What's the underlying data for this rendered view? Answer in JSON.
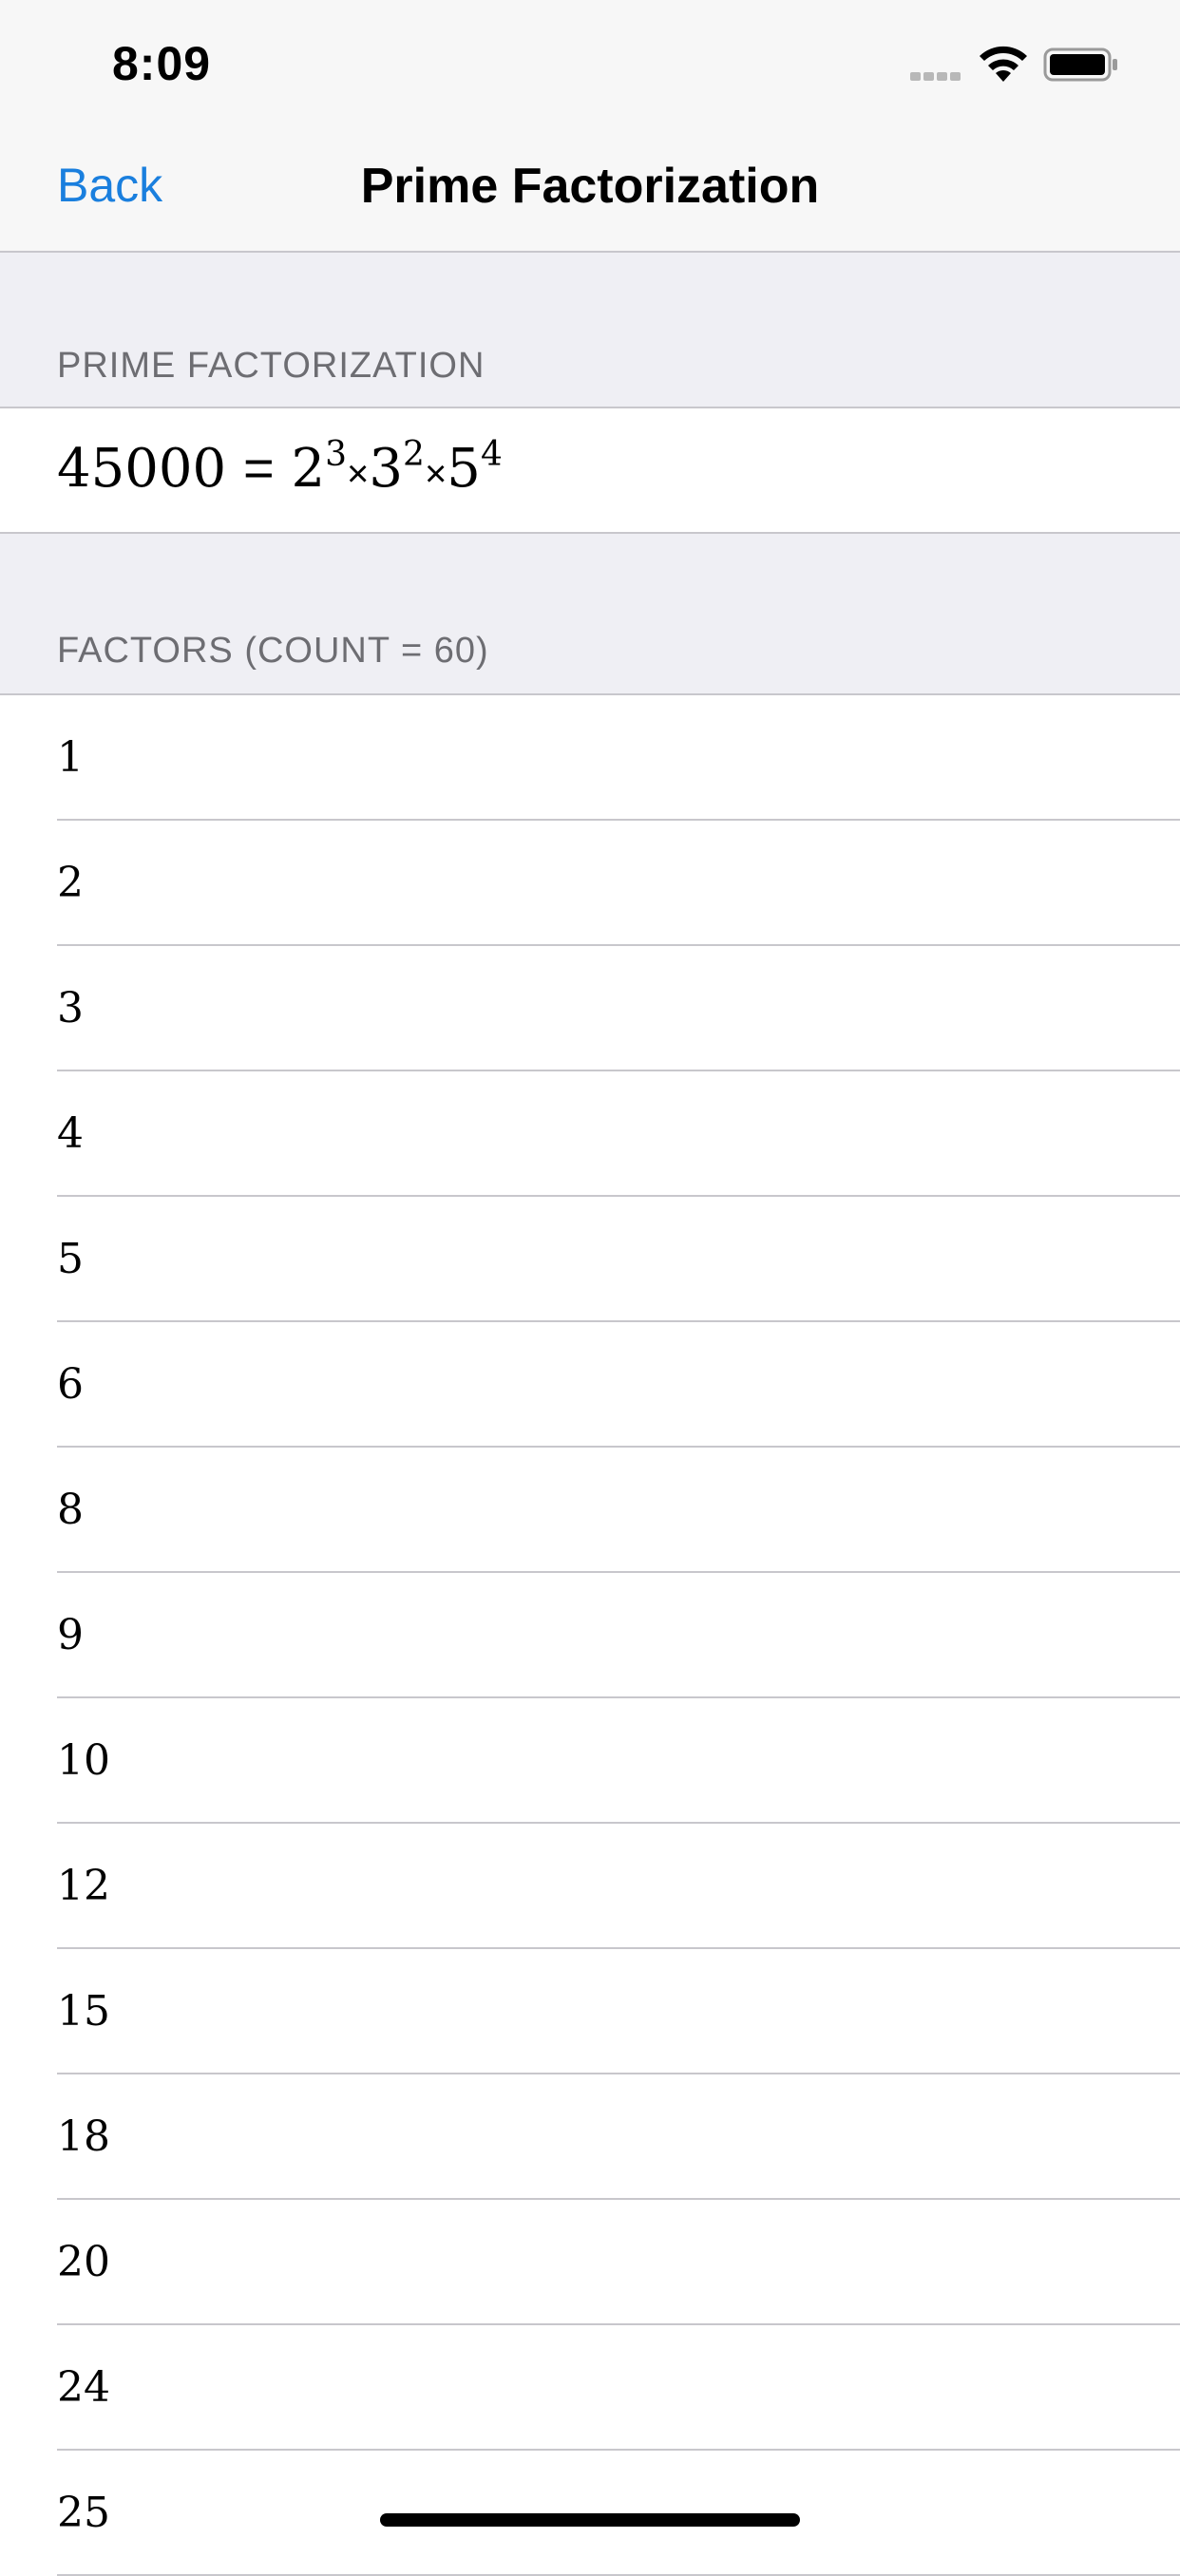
{
  "status_bar": {
    "time": "8:09"
  },
  "nav": {
    "back_label": "Back",
    "title": "Prime Factorization"
  },
  "prime_section": {
    "header": "PRIME FACTORIZATION",
    "number": "45000",
    "equals": "=",
    "terms": [
      {
        "base": "2",
        "exponent": "3"
      },
      {
        "base": "3",
        "exponent": "2"
      },
      {
        "base": "5",
        "exponent": "4"
      }
    ],
    "times": "×"
  },
  "factors_section": {
    "header": "FACTORS (COUNT = 60)",
    "items": [
      "1",
      "2",
      "3",
      "4",
      "5",
      "6",
      "8",
      "9",
      "10",
      "12",
      "15",
      "18",
      "20",
      "24",
      "25"
    ]
  },
  "colors": {
    "accent": "#1a7fde",
    "grouped_background": "#efeff4",
    "separator": "#c8c7cc",
    "section_header_text": "#6d6d72"
  },
  "icons": [
    "signal-icon",
    "wifi-icon",
    "battery-icon"
  ]
}
